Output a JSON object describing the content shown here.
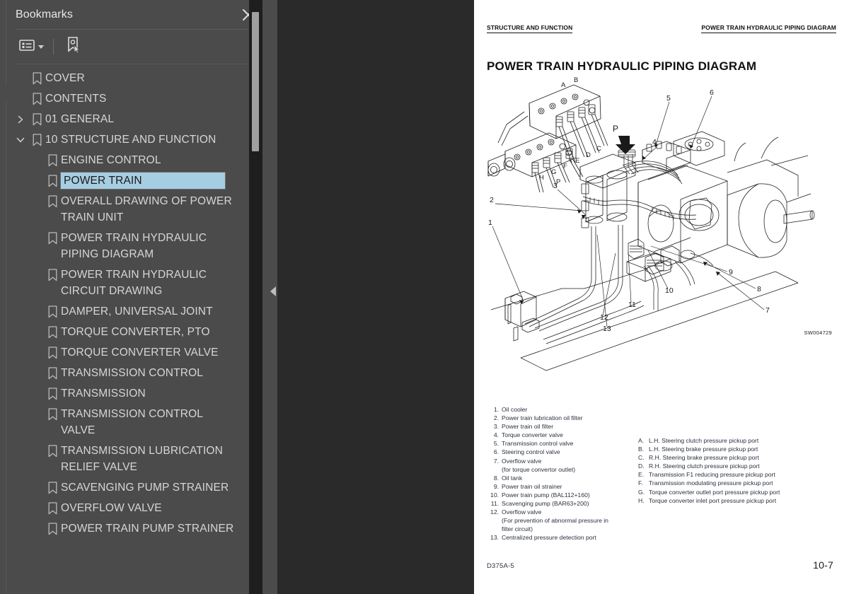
{
  "sidebar": {
    "title": "Bookmarks",
    "close_icon": "close-icon",
    "toolbar": {
      "options_icon": "list-options-icon",
      "caret_icon": "chevron-down-icon",
      "new_bookmark_icon": "new-bookmark-icon"
    },
    "items": [
      {
        "label": "COVER",
        "level": 0,
        "twisty": "none",
        "selected": false
      },
      {
        "label": "CONTENTS",
        "level": 0,
        "twisty": "none",
        "selected": false
      },
      {
        "label": "01 GENERAL",
        "level": 0,
        "twisty": "collapsed",
        "selected": false
      },
      {
        "label": "10 STRUCTURE AND FUNCTION",
        "level": 0,
        "twisty": "expanded",
        "selected": false
      },
      {
        "label": "ENGINE CONTROL",
        "level": 1,
        "twisty": "none",
        "selected": false
      },
      {
        "label": "POWER TRAIN",
        "level": 1,
        "twisty": "none",
        "selected": true
      },
      {
        "label": "OVERALL DRAWING OF POWER TRAIN UNIT",
        "level": 1,
        "twisty": "none",
        "selected": false
      },
      {
        "label": "POWER TRAIN HYDRAULIC PIPING DIAGRAM",
        "level": 1,
        "twisty": "none",
        "selected": false
      },
      {
        "label": "POWER TRAIN HYDRAULIC CIRCUIT DRAWING",
        "level": 1,
        "twisty": "none",
        "selected": false
      },
      {
        "label": "DAMPER, UNIVERSAL JOINT",
        "level": 1,
        "twisty": "none",
        "selected": false
      },
      {
        "label": "TORQUE CONVERTER, PTO",
        "level": 1,
        "twisty": "none",
        "selected": false
      },
      {
        "label": "TORQUE CONVERTER VALVE",
        "level": 1,
        "twisty": "none",
        "selected": false
      },
      {
        "label": "TRANSMISSION CONTROL",
        "level": 1,
        "twisty": "none",
        "selected": false
      },
      {
        "label": "TRANSMISSION",
        "level": 1,
        "twisty": "none",
        "selected": false
      },
      {
        "label": "TRANSMISSION CONTROL VALVE",
        "level": 1,
        "twisty": "none",
        "selected": false
      },
      {
        "label": "TRANSMISSION LUBRICATION RELIEF VALVE",
        "level": 1,
        "twisty": "none",
        "selected": false
      },
      {
        "label": "SCAVENGING PUMP STRAINER",
        "level": 1,
        "twisty": "none",
        "selected": false
      },
      {
        "label": "OVERFLOW VALVE",
        "level": 1,
        "twisty": "none",
        "selected": false
      },
      {
        "label": "POWER TRAIN PUMP STRAINER",
        "level": 1,
        "twisty": "none",
        "selected": false
      }
    ]
  },
  "viewer": {
    "collapse_icon": "collapse-panel-arrow-icon"
  },
  "page": {
    "running_head_left": "STRUCTURE AND FUNCTION",
    "running_head_right": "POWER TRAIN HYDRAULIC PIPING DIAGRAM",
    "title": "POWER TRAIN HYDRAULIC PIPING DIAGRAM",
    "drawing_id": "SW004729",
    "footer_left": "D375A-5",
    "footer_right": "10-7",
    "figure_callouts": [
      "1",
      "2",
      "3",
      "4",
      "5",
      "6",
      "7",
      "8",
      "9",
      "10",
      "11",
      "12",
      "13"
    ],
    "figure_port_labels": [
      "A",
      "B",
      "C",
      "D",
      "E",
      "F",
      "G",
      "H",
      "P"
    ],
    "legend_numbered": [
      {
        "n": "1.",
        "t": "Oil cooler"
      },
      {
        "n": "2.",
        "t": "Power train lubrication oil filter"
      },
      {
        "n": "3.",
        "t": "Power train oil filter"
      },
      {
        "n": "4.",
        "t": "Torque converter valve"
      },
      {
        "n": "5.",
        "t": "Transmission control valve"
      },
      {
        "n": "6.",
        "t": "Steering control valve"
      },
      {
        "n": "7.",
        "t": "Overflow valve"
      },
      {
        "n": "",
        "t": "(for torque convertor outlet)",
        "cont": true
      },
      {
        "n": "8.",
        "t": "Oil tank"
      },
      {
        "n": "9.",
        "t": "Power train oil strainer"
      },
      {
        "n": "10.",
        "t": "Power train pump (BAL112+160)"
      },
      {
        "n": "11.",
        "t": "Scavenging pump (BAR63+200)"
      },
      {
        "n": "12.",
        "t": "Overflow valve"
      },
      {
        "n": "",
        "t": "(For prevention of abnormal pressure in",
        "cont": true
      },
      {
        "n": "",
        "t": "filter circuit)",
        "cont": true
      },
      {
        "n": "13.",
        "t": "Centralized pressure detection port"
      }
    ],
    "legend_lettered": [
      {
        "n": "A.",
        "t": "L.H. Steering clutch pressure pickup port"
      },
      {
        "n": "B.",
        "t": "L.H. Steering brake pressure pickup port"
      },
      {
        "n": "C.",
        "t": "R.H. Steering brake pressure pickup port"
      },
      {
        "n": "D.",
        "t": "R.H. Steering clutch pressure pickup port"
      },
      {
        "n": "E.",
        "t": "Transmission F1 reducing pressure pickup port"
      },
      {
        "n": "F.",
        "t": "Transmission modulating pressure pickup port"
      },
      {
        "n": "G.",
        "t": "Torque converter outlet port pressure pickup port"
      },
      {
        "n": "H.",
        "t": "Torque converter inlet port pressure pickup port"
      }
    ]
  },
  "colors": {
    "sidebar_bg": "#4b4b4b",
    "viewer_bg": "#2a2a2a",
    "selection": "#a6cee3",
    "page_bg": "#ffffff",
    "legend_text": "#2c3140"
  }
}
